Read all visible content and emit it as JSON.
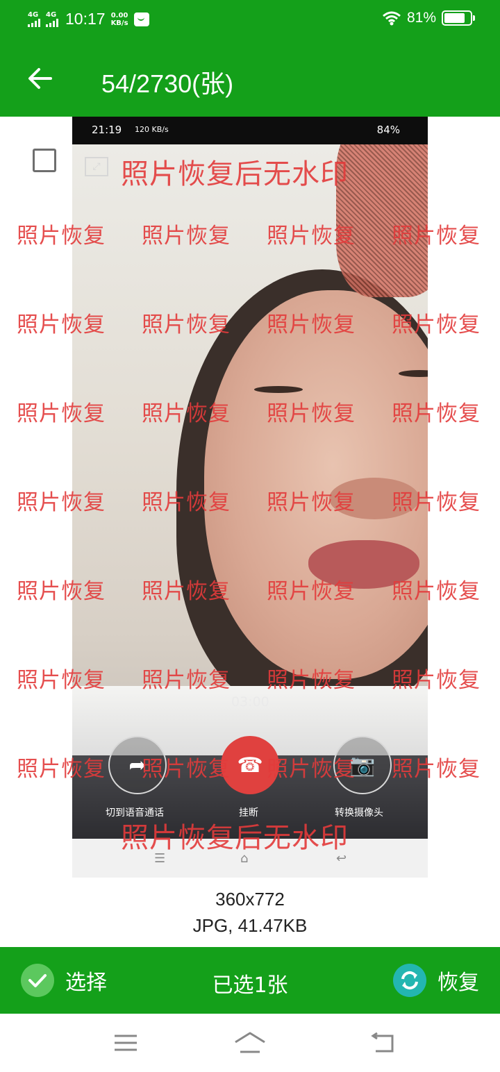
{
  "status_bar": {
    "network1": "4G",
    "network2": "4G",
    "time": "10:17",
    "speed_value": "0.00",
    "speed_unit": "KB/s",
    "battery_pct": "81%",
    "battery_level": 0.81
  },
  "app_bar": {
    "title": "54/2730(张)"
  },
  "photo": {
    "status_time": "21:19",
    "status_speed": "120 KB/s",
    "status_battery": "84%",
    "watermark_small": "照片恢复",
    "watermark_large": "照片恢复后无水印",
    "call_timer": "03:00",
    "call_switch_label": "切到语音通话",
    "call_hangup_label": "挂断",
    "call_camera_label": "转换摄像头",
    "nav_menu": "☰",
    "nav_home": "⌂",
    "nav_back": "↩"
  },
  "info": {
    "resolution": "360x772",
    "format_size": "JPG, 41.47KB"
  },
  "action_bar": {
    "select_label": "选择",
    "selected_count": "已选1张",
    "restore_label": "恢复"
  },
  "colors": {
    "primary_green": "#14a01a",
    "check_green": "#5cc85e",
    "restore_teal": "#23b6b1",
    "watermark_red": "#e33b3b"
  },
  "icons": [
    "back-arrow-icon",
    "checkbox-icon",
    "check-icon",
    "restore-icon",
    "menu-icon",
    "home-icon",
    "back-icon"
  ]
}
